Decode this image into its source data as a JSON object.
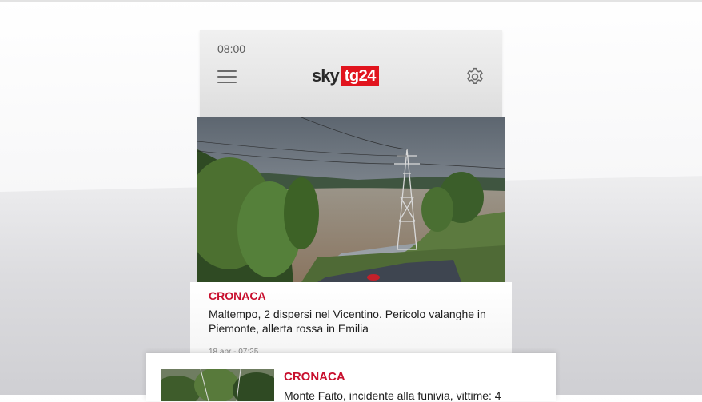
{
  "status_bar": {
    "time": "08:00"
  },
  "header": {
    "logo_sky": "sky",
    "logo_tg": "tg24",
    "menu_icon": "hamburger-menu-icon",
    "settings_icon": "gear-icon"
  },
  "articles": [
    {
      "category": "CRONACA",
      "headline": "Maltempo, 2 dispersi nel Vicentino. Pericolo valanghe in Piemonte, allerta rossa in Emilia",
      "date": "18 apr - 07:25"
    },
    {
      "category": "CRONACA",
      "headline": "Monte Faito, incidente alla funivia, vittime: 4"
    }
  ],
  "colors": {
    "accent": "#c8102e",
    "logo_red": "#e1141e"
  }
}
